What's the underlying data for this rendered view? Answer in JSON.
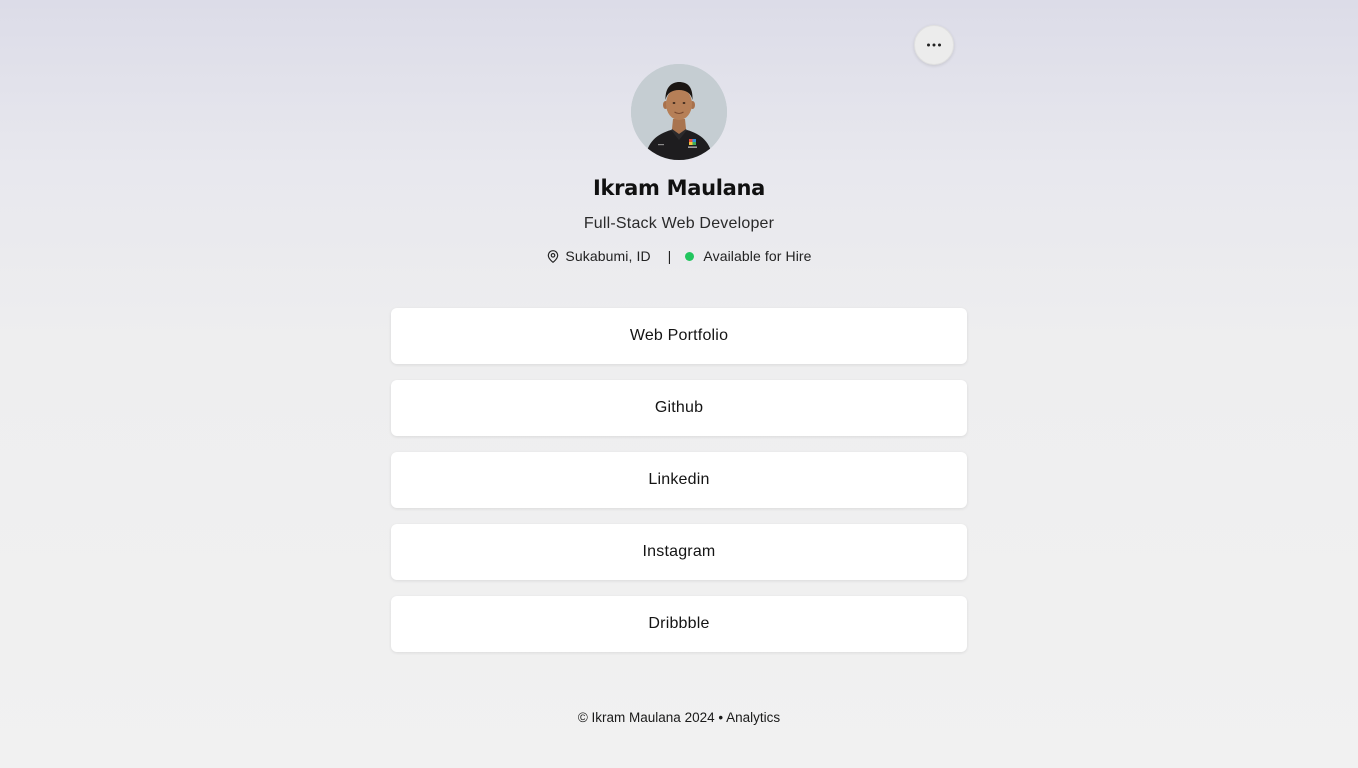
{
  "header": {
    "menu_icon": "more-horizontal-icon"
  },
  "profile": {
    "avatar_alt": "Ikram Maulana",
    "name": "Ikram Maulana",
    "role": "Full-Stack Web Developer",
    "location": "Sukabumi, ID",
    "location_icon": "map-pin-icon",
    "separator": "|",
    "availability": "Available for Hire",
    "availability_color": "#22c55e"
  },
  "links": [
    {
      "label": "Web Portfolio"
    },
    {
      "label": "Github"
    },
    {
      "label": "Linkedin"
    },
    {
      "label": "Instagram"
    },
    {
      "label": "Dribbble"
    }
  ],
  "footer": {
    "copyright": "© Ikram Maulana 2024",
    "bullet": "•",
    "analytics_link": "Analytics"
  }
}
